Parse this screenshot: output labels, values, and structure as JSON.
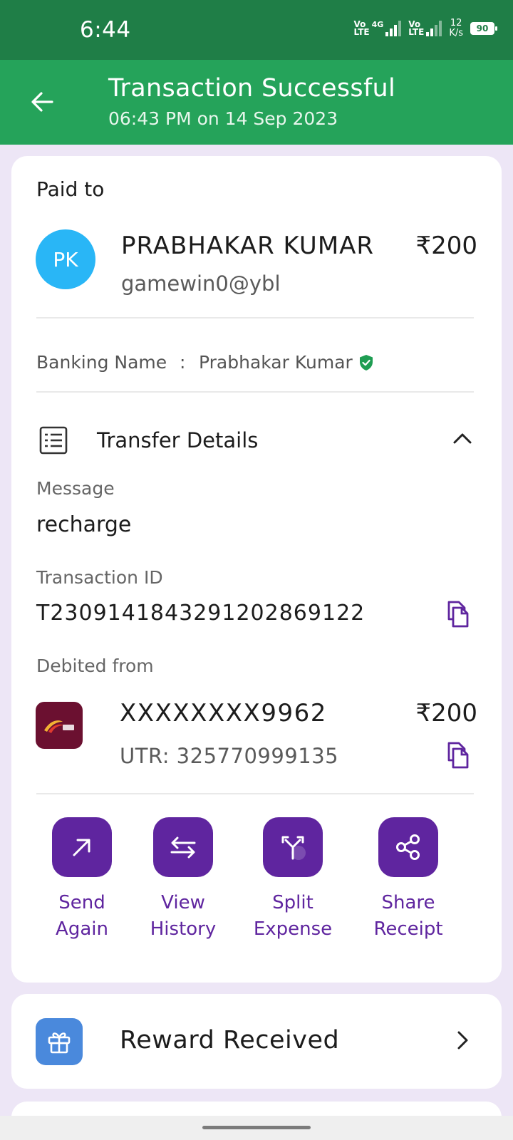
{
  "status_bar": {
    "time": "6:44",
    "network1": {
      "line1": "Vo",
      "line2": "LTE",
      "gen": "4G"
    },
    "network2": {
      "line1": "Vo",
      "line2": "LTE"
    },
    "speed_value": "12",
    "speed_unit": "K/s",
    "battery": "90"
  },
  "header": {
    "title": "Transaction Successful",
    "subtitle": "06:43 PM on 14 Sep 2023"
  },
  "payee": {
    "section_label": "Paid to",
    "initials": "PK",
    "name": "PRABHAKAR KUMAR",
    "vpa": "gamewin0@ybl",
    "amount": "₹200"
  },
  "banking_name": {
    "label": "Banking Name",
    "separator": ":",
    "value": "Prabhakar Kumar"
  },
  "transfer_details": {
    "title": "Transfer Details",
    "message_label": "Message",
    "message_value": "recharge",
    "transaction_id_label": "Transaction ID",
    "transaction_id_value": "T2309141843291202869122",
    "debited_from_label": "Debited from",
    "account_number": "XXXXXXXX9962",
    "account_amount": "₹200",
    "utr": "UTR: 325770999135"
  },
  "actions": [
    {
      "line1": "Send",
      "line2": "Again",
      "icon": "arrow-up-right-icon"
    },
    {
      "line1": "View",
      "line2": "History",
      "icon": "swap-arrows-icon"
    },
    {
      "line1": "Split",
      "line2": "Expense",
      "icon": "split-icon"
    },
    {
      "line1": "Share",
      "line2": "Receipt",
      "icon": "share-icon"
    }
  ],
  "reward": {
    "label": "Reward Received",
    "icon": "gift-icon"
  },
  "colors": {
    "status_bar": "#1f7e47",
    "header": "#25a35a",
    "brand_purple": "#5f259f",
    "avatar": "#29b6f6",
    "background": "#ede6f6",
    "verified": "#1e9d52",
    "reward_icon_bg": "#4a89dc"
  }
}
